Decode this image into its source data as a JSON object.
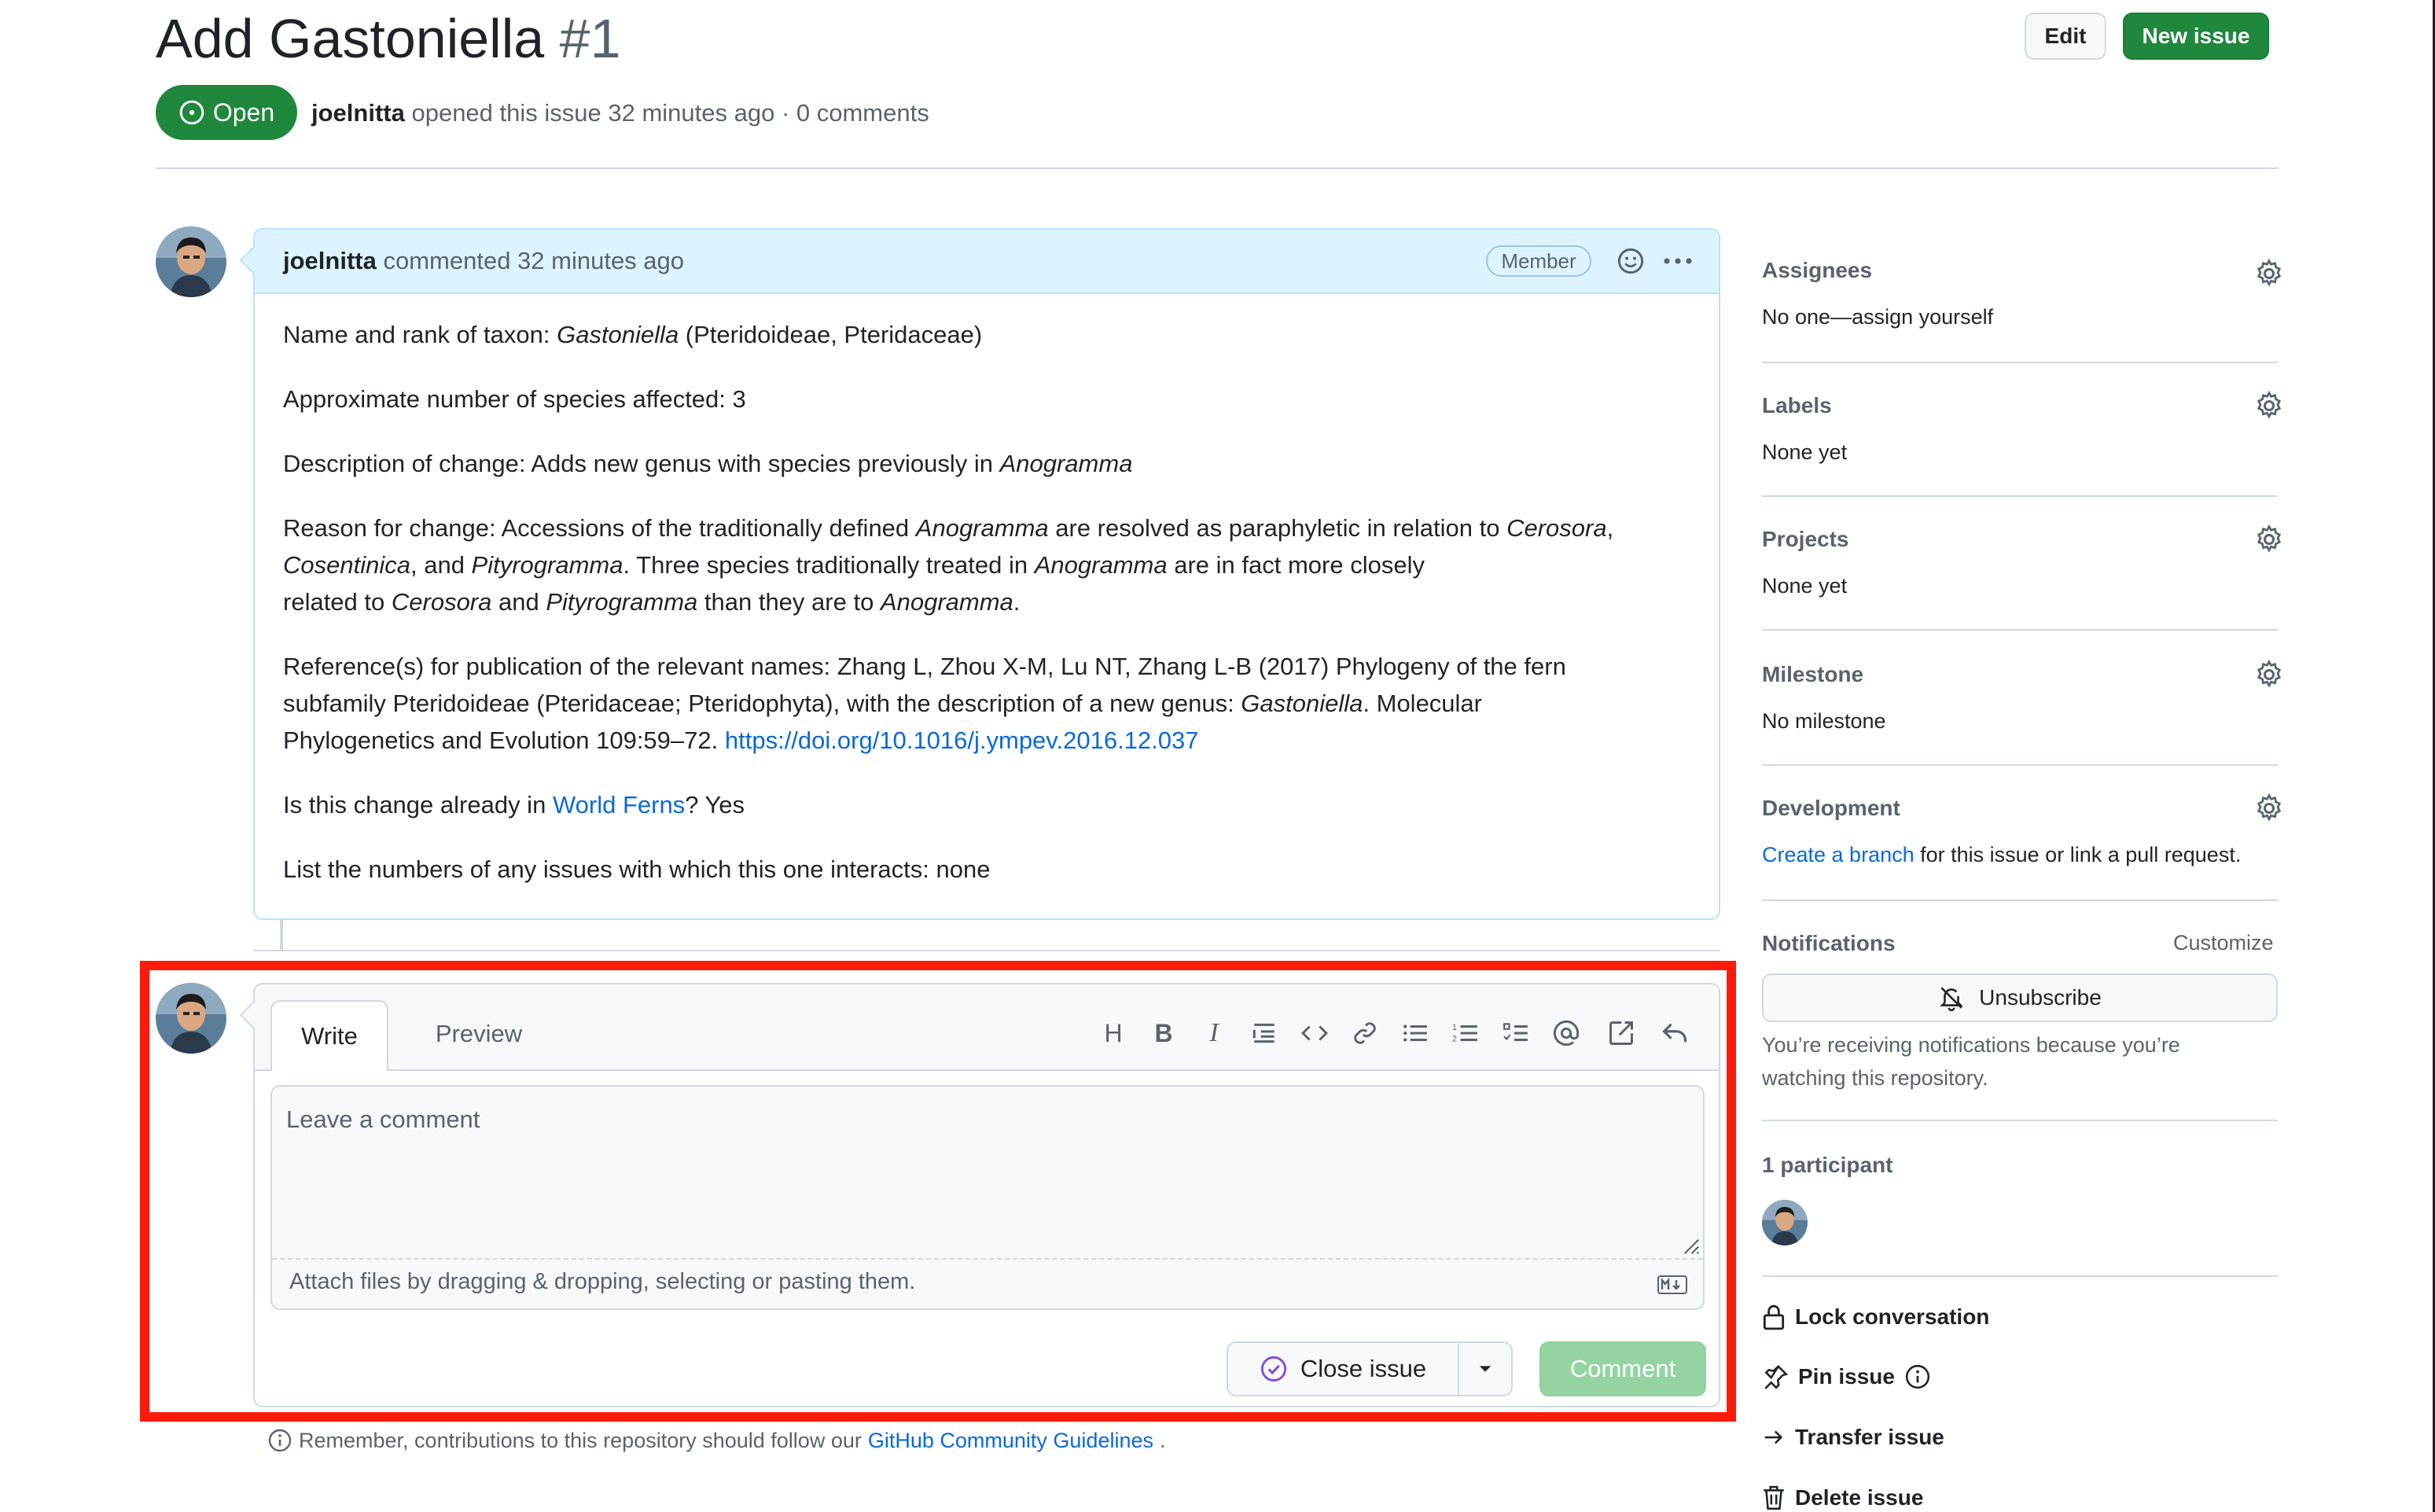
{
  "issue": {
    "title": "Add Gastoniella",
    "number": "#1",
    "state": "Open",
    "author": "joelnitta",
    "opened_text": "opened this issue 32 minutes ago · 0 comments"
  },
  "header_actions": {
    "edit": "Edit",
    "new_issue": "New issue"
  },
  "comment": {
    "author": "joelnitta",
    "action_text": "commented 32 minutes ago",
    "badge": "Member",
    "body": {
      "p1_prefix": "Name and rank of taxon: ",
      "p1_italic": "Gastoniella",
      "p1_suffix": " (Pteridoideae, Pteridaceae)",
      "p2": "Approximate number of species affected: 3",
      "p3_prefix": "Description of change: Adds new genus with species previously in ",
      "p3_italic": "Anogramma",
      "p4_a": "Reason for change: Accessions of the traditionally defined ",
      "p4_b": "Anogramma",
      "p4_c": " are resolved as paraphyletic in relation to ",
      "p4_d": "Cerosora",
      "p4_e": ",",
      "p4_f": "Cosentinica",
      "p4_g": ", and ",
      "p4_h": "Pityrogramma",
      "p4_i": ". Three species traditionally treated in ",
      "p4_j": "Anogramma",
      "p4_k": " are in fact more closely",
      "p4_l": "related to ",
      "p4_m": "Cerosora",
      "p4_n": " and ",
      "p4_o": "Pityrogramma",
      "p4_p": " than they are to ",
      "p4_q": "Anogramma",
      "p4_r": ".",
      "p5_a": "Reference(s) for publication of the relevant names: Zhang L, Zhou X-M, Lu NT, Zhang L-B (2017) Phylogeny of the fern",
      "p5_b": "subfamily Pteridoideae (Pteridaceae; Pteridophyta), with the description of a new genus: ",
      "p5_c": "Gastoniella",
      "p5_d": ". Molecular",
      "p5_e": "Phylogenetics and Evolution 109:59–72. ",
      "p5_link": "https://doi.org/10.1016/j.ympev.2016.12.037",
      "p6_prefix": "Is this change already in ",
      "p6_link": "World Ferns",
      "p6_suffix": "? Yes",
      "p7": "List the numbers of any issues with which this one interacts: none"
    }
  },
  "composer": {
    "tabs": [
      "Write",
      "Preview"
    ],
    "placeholder": "Leave a comment",
    "attach_text": "Attach files by dragging & dropping, selecting or pasting them.",
    "close_issue": "Close issue",
    "comment_button": "Comment",
    "toolbar_icons": [
      "heading-icon",
      "bold-icon",
      "italic-icon",
      "quote-icon",
      "code-icon",
      "link-icon",
      "unordered-list-icon",
      "ordered-list-icon",
      "task-list-icon",
      "mention-icon",
      "reference-icon",
      "reply-icon"
    ]
  },
  "guidelines": {
    "prefix": "Remember, contributions to this repository should follow our ",
    "link": "GitHub Community Guidelines",
    "suffix": "."
  },
  "sidebar": {
    "assignees": {
      "title": "Assignees",
      "value": "No one—assign yourself"
    },
    "labels": {
      "title": "Labels",
      "value": "None yet"
    },
    "projects": {
      "title": "Projects",
      "value": "None yet"
    },
    "milestone": {
      "title": "Milestone",
      "value": "No milestone"
    },
    "development": {
      "title": "Development",
      "link": "Create a branch",
      "suffix": " for this issue or link a pull request."
    },
    "notifications": {
      "title": "Notifications",
      "customize": "Customize",
      "unsubscribe": "Unsubscribe",
      "note": "You’re receiving notifications because you’re watching this repository."
    },
    "participants": {
      "title": "1 participant"
    },
    "actions": {
      "lock": "Lock conversation",
      "pin": "Pin issue",
      "transfer": "Transfer issue",
      "delete": "Delete issue"
    }
  },
  "colors": {
    "open_green": "#1f883d",
    "link_blue": "#0969da",
    "comment_header_bg": "#ddf4ff",
    "highlight_red": "#ff1a0a",
    "comment_button_disabled": "#94d3a2"
  }
}
